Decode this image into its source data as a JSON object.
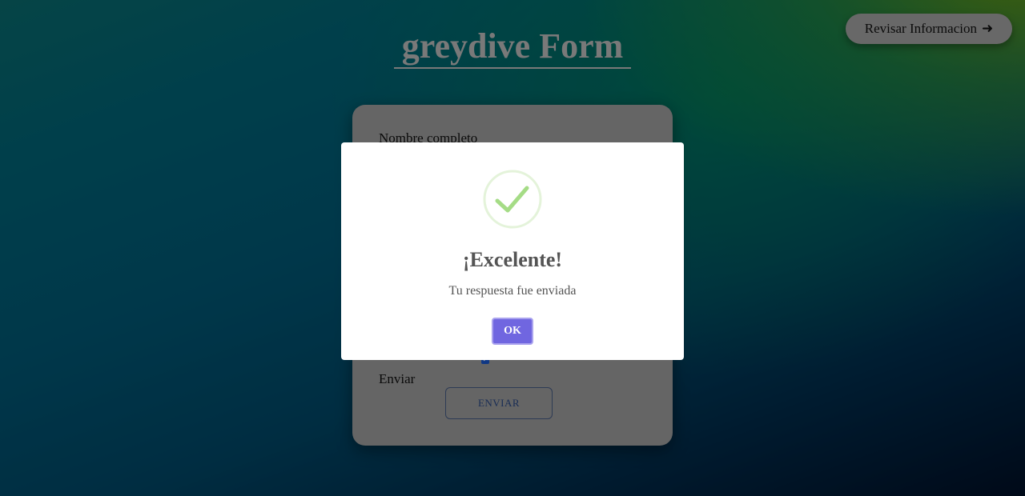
{
  "header": {
    "title": "greydive Form"
  },
  "review_button": {
    "label": "Revisar Informacion",
    "icon": "arrow-right-icon"
  },
  "form": {
    "first_field_label": "Nombre completo",
    "checkbox_checked": true,
    "submit_label": "Enviar",
    "submit_button": "ENVIAR"
  },
  "modal": {
    "icon": "success-check-icon",
    "title": "¡Excelente!",
    "message": "Tu respuesta fue enviada",
    "ok_label": "OK"
  },
  "colors": {
    "ok_button": "#7066e0",
    "success_icon": "#a5dc86",
    "card": "#a3a3a3"
  }
}
